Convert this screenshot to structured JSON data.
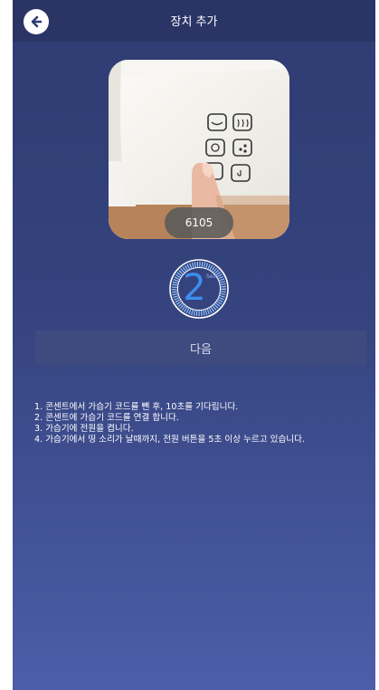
{
  "header": {
    "title": "장치 추가",
    "back_icon": "back-arrow-icon"
  },
  "device": {
    "code": "6105"
  },
  "timer": {
    "value": "2",
    "unit": "Sec"
  },
  "next_button": {
    "label": "다음"
  },
  "instructions": [
    "1. 콘센트에서 가습기 코드를 뺀 후, 10초를 기다립니다.",
    "2. 콘센트에 가습기 코드를 연결 합니다.",
    "3. 가습기에 전원을 켭니다.",
    "4. 가습기에서 띵 소리가 날때까지, 전원 버튼을 5초 이상 누르고 있습니다."
  ],
  "colors": {
    "accent": "#3d8ef0",
    "header_bg": "#2a3566"
  }
}
